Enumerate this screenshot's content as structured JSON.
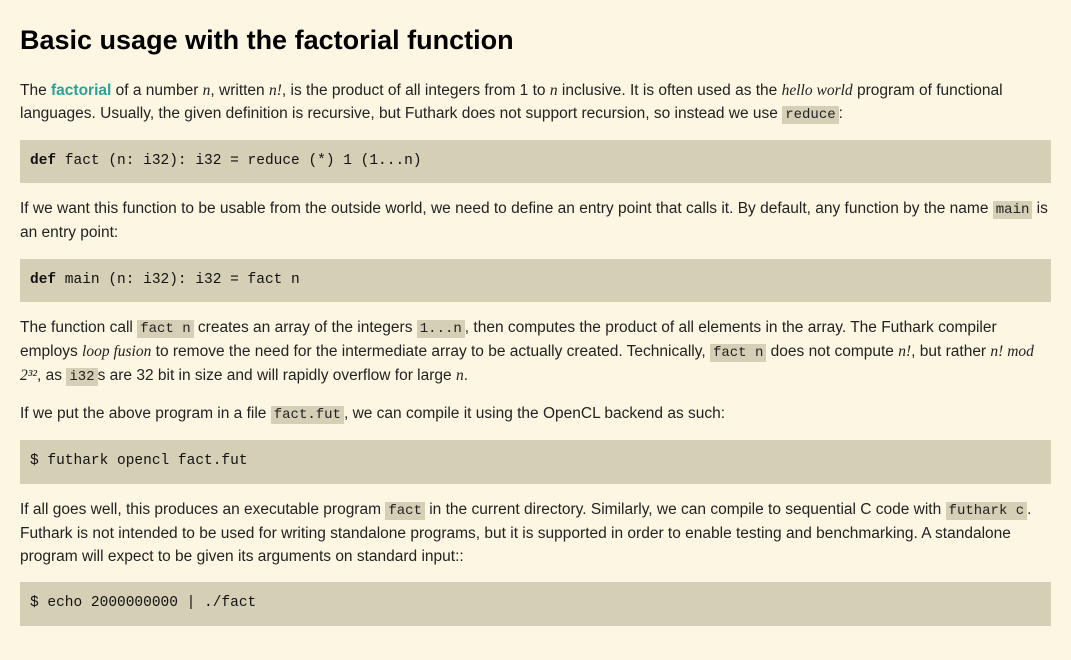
{
  "heading": "Basic usage with the factorial function",
  "p1": {
    "t1": "The ",
    "link": "factorial",
    "t2": " of a number ",
    "n1": "n",
    "t3": ", written ",
    "nfact": "n!",
    "t4": ", is the product of all integers from 1 to ",
    "n2": "n",
    "t5": " inclusive. It is often used as the ",
    "hw": "hello world",
    "t6": " program of functional languages. Usually, the given definition is recursive, but Futhark does not support recursion, so instead we use ",
    "reduce": "reduce",
    "t7": ":"
  },
  "code1": {
    "kw": "def",
    "rest": " fact (n: i32): i32 = reduce (*) 1 (1...n)"
  },
  "p2": {
    "t1": "If we want this function to be usable from the outside world, we need to define an entry point that calls it. By default, any function by the name ",
    "main": "main",
    "t2": " is an entry point:"
  },
  "code2": {
    "kw": "def",
    "rest": " main (n: i32): i32 = fact n"
  },
  "p3": {
    "t1": "The function call ",
    "factn1": "fact n",
    "t2": " creates an array of the integers ",
    "range": "1...n",
    "t3": ", then computes the product of all elements in the array. The Futhark compiler employs ",
    "loop": "loop fusion",
    "t4": " to remove the need for the intermediate array to be actually created. Technically, ",
    "factn2": "fact n",
    "t5": " does not compute ",
    "nfact": "n!",
    "t6": ", but rather ",
    "mod": "n! mod 2³²",
    "t7": ", as ",
    "i32": "i32",
    "t8": "s are 32 bit in size and will rapidly overflow for large ",
    "n": "n",
    "t9": "."
  },
  "p4": {
    "t1": "If we put the above program in a file ",
    "file": "fact.fut",
    "t2": ", we can compile it using the OpenCL backend as such:"
  },
  "code3": "$ futhark opencl fact.fut",
  "p5": {
    "t1": "If all goes well, this produces an executable program ",
    "fact": "fact",
    "t2": " in the current directory. Similarly, we can compile to sequential C code with ",
    "fc": "futhark c",
    "t3": ". Futhark is not intended to be used for writing standalone programs, but it is supported in order to enable testing and benchmarking. A standalone program will expect to be given its arguments on standard input::"
  },
  "code4": "$ echo 2000000000 | ./fact"
}
